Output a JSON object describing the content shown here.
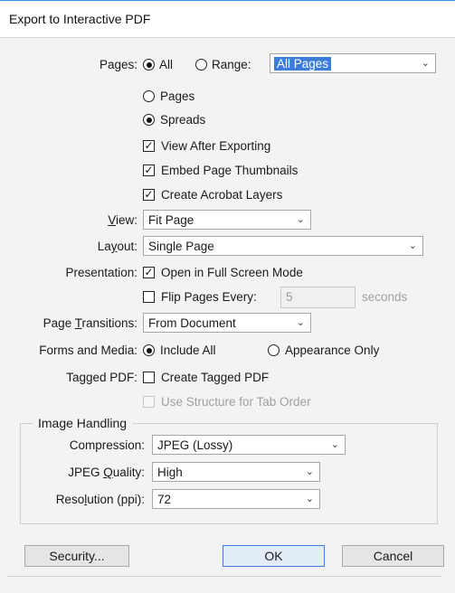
{
  "window": {
    "title": "Export to Interactive PDF"
  },
  "pages": {
    "label": "Pages:",
    "all_label": "All",
    "range_label": "Range:",
    "range_value": "All Pages",
    "pages_option": "Pages",
    "spreads_option": "Spreads",
    "selected_mode": "All",
    "layout_selected": "Spreads"
  },
  "options": {
    "view_after_exporting": "View After Exporting",
    "embed_thumbnails": "Embed Page Thumbnails",
    "create_layers": "Create Acrobat Layers"
  },
  "view": {
    "label": "View:",
    "value": "Fit Page"
  },
  "layout": {
    "label": "Layout:",
    "value": "Single Page"
  },
  "presentation": {
    "label": "Presentation:",
    "full_screen": "Open in Full Screen Mode",
    "flip_label": "Flip Pages Every:",
    "flip_value": "5",
    "flip_unit": "seconds"
  },
  "transitions": {
    "label": "Page Transitions:",
    "value": "From Document"
  },
  "forms": {
    "label": "Forms and Media:",
    "include_all": "Include All",
    "appearance_only": "Appearance Only"
  },
  "tagged": {
    "label": "Tagged PDF:",
    "create": "Create Tagged PDF",
    "structure": "Use Structure for Tab Order"
  },
  "image": {
    "group_title": "Image Handling",
    "compression_label": "Compression:",
    "compression_value": "JPEG (Lossy)",
    "quality_label": "JPEG Quality:",
    "quality_value": "High",
    "resolution_label": "Resolution (ppi):",
    "resolution_value": "72"
  },
  "buttons": {
    "security": "Security...",
    "ok": "OK",
    "cancel": "Cancel"
  },
  "colors": {
    "accent": "#3b7dd8",
    "dialog_bg": "#f3f3f3"
  }
}
